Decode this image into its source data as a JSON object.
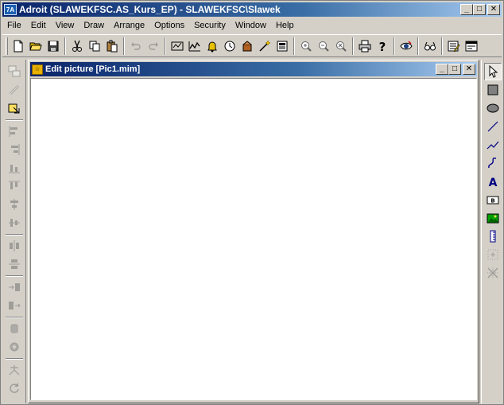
{
  "window": {
    "title": "Adroit (SLAWEKFSC.AS_Kurs_EP) - SLAWEKFSC\\Slawek",
    "icon_label": "7A",
    "minimize_glyph": "_",
    "maximize_glyph": "□",
    "close_glyph": "✕"
  },
  "menu": [
    {
      "label": "File"
    },
    {
      "label": "Edit"
    },
    {
      "label": "View"
    },
    {
      "label": "Draw"
    },
    {
      "label": "Arrange"
    },
    {
      "label": "Options"
    },
    {
      "label": "Security"
    },
    {
      "label": "Window"
    },
    {
      "label": "Help"
    }
  ],
  "toolbar_icons": [
    "new-icon",
    "open-icon",
    "save-icon",
    "cut-icon",
    "copy-icon",
    "paste-icon",
    "undo-icon",
    "redo-icon",
    "tag-icon",
    "trend-icon",
    "alarm-bell-icon",
    "clock-icon",
    "database-icon",
    "wizard-icon",
    "report-icon",
    "zoom-in-icon",
    "zoom-out-icon",
    "zoom-fit-icon",
    "print-icon",
    "help-icon",
    "security-icon",
    "preview-icon",
    "config-icon",
    "window-icon"
  ],
  "child_window": {
    "title": "Edit picture [Pic1.mim]",
    "icon_label": "☆"
  },
  "colors": {
    "titlebar_start": "#0a246a",
    "titlebar_end": "#a6caf0",
    "face": "#d4d0c8",
    "canvas": "#ffffff"
  }
}
